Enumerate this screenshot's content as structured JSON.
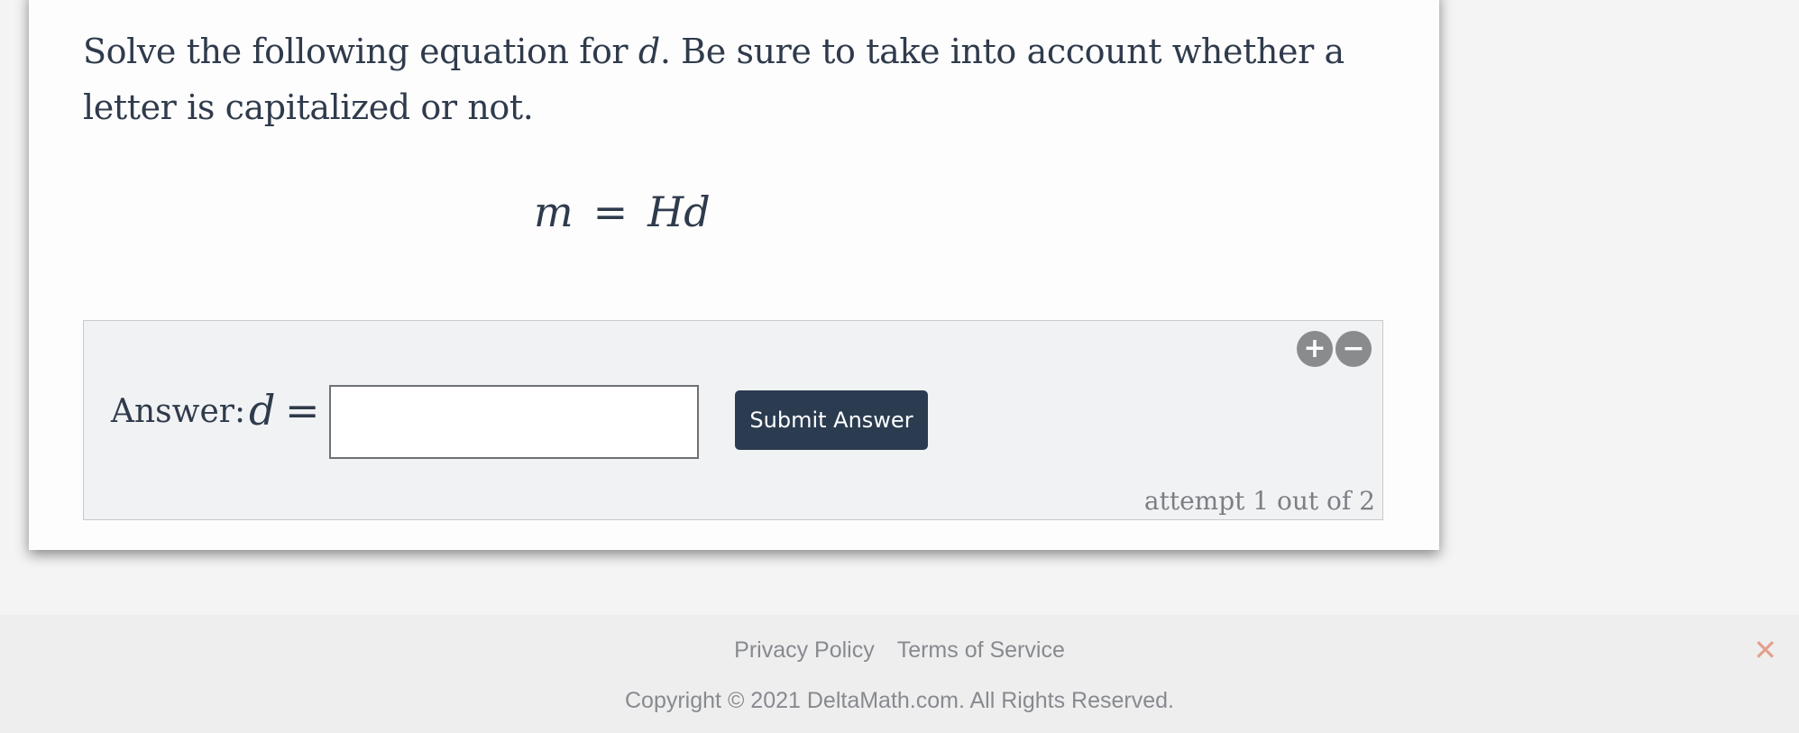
{
  "question": {
    "text_before": "Solve the following equation for ",
    "variable": "d",
    "text_after": ". Be sure to take into account whether a letter is capitalized or not."
  },
  "equation": {
    "left": "m",
    "operator": "=",
    "right": "Hd"
  },
  "answer": {
    "label": "Answer:",
    "variable": "d",
    "operator": "=",
    "input_value": "",
    "submit_label": "Submit Answer",
    "attempt_text": "attempt 1 out of 2",
    "zoom_in_icon": "plus-icon",
    "zoom_out_icon": "minus-icon"
  },
  "footer": {
    "privacy_label": "Privacy Policy",
    "terms_label": "Terms of Service",
    "copyright": "Copyright © 2021 DeltaMath.com. All Rights Reserved.",
    "close_icon": "close-icon"
  },
  "colors": {
    "button_bg": "#2b3c50",
    "text": "#2f3b4c",
    "panel_bg": "#f1f2f3",
    "close_icon": "#e59f8d"
  }
}
